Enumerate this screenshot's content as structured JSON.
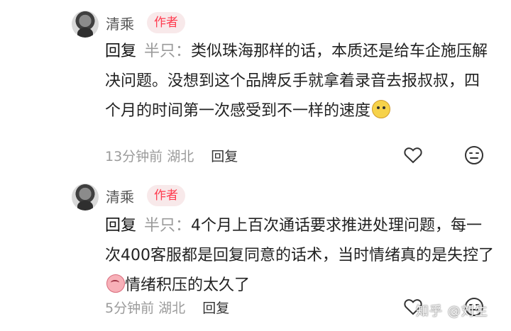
{
  "comments": [
    {
      "username": "清乘",
      "badge": "作者",
      "reply_word": "回复",
      "reply_target": "半只：",
      "body": "类似珠海那样的话，本质还是给车企施压解决问题。没想到这个品牌反手就拿着录音去报叔叔，四个月的时间第一次感受到不一样的速度",
      "time": "13分钟前",
      "location": "湖北",
      "reply_label": "回复",
      "emoji": "yellow-face-emoji"
    },
    {
      "username": "清乘",
      "badge": "作者",
      "reply_word": "回复",
      "reply_target": "半只：",
      "body": "4个月上百次通话要求推进处理问题，每一次400客服都是回复同意的话术，当时情绪真的是失控了",
      "body_suffix": "情绪积压的太久了",
      "time": "5分钟前",
      "location": "湖北",
      "reply_label": "回复",
      "emoji": "crying-face-emoji"
    }
  ],
  "watermark": "知乎 @刘生",
  "colors": {
    "badge_bg": "#f8e9ea",
    "badge_text": "#ff3b4f",
    "meta_text": "#9b9b9b"
  },
  "icons": {
    "like": "heart-outline-icon",
    "reaction": "neutral-face-icon"
  }
}
